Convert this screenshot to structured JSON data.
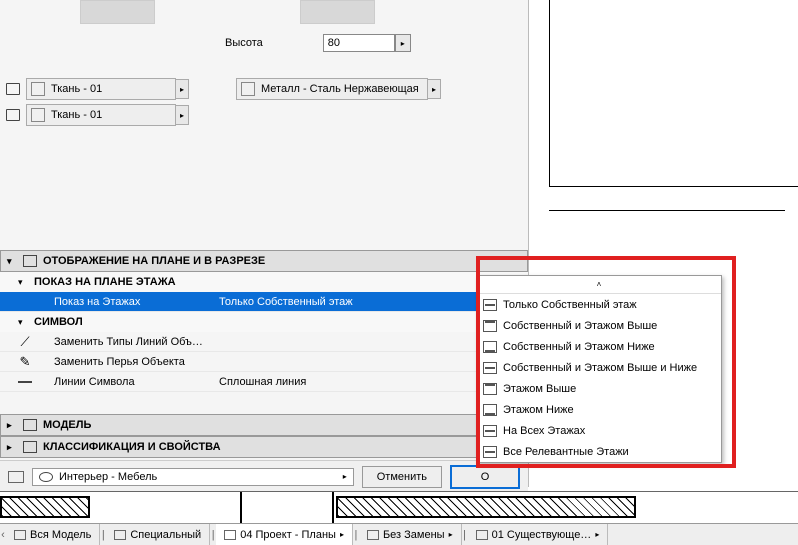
{
  "height": {
    "label": "Высота",
    "value": "80"
  },
  "materials": {
    "fabric1": "Ткань - 01",
    "fabric2": "Ткань - 01",
    "metal": "Металл - Сталь Нержавеющая"
  },
  "sections": {
    "display": {
      "title": "ОТОБРАЖЕНИЕ НА ПЛАНЕ И В РАЗРЕЗЕ"
    },
    "floorplan_show": {
      "title": "ПОКАЗ НА ПЛАНЕ ЭТАЖА"
    },
    "symbol": {
      "title": "СИМВОЛ"
    },
    "model": {
      "title": "МОДЕЛЬ"
    },
    "class": {
      "title": "КЛАССИФИКАЦИЯ И СВОЙСТВА"
    }
  },
  "props": {
    "show_on_floors": {
      "label": "Показ на Этажах",
      "value": "Только Собственный этаж"
    },
    "replace_line_types": {
      "label": "Заменить Типы Линий Объ…"
    },
    "replace_pens": {
      "label": "Заменить Перья Объекта"
    },
    "symbol_lines": {
      "label": "Линии Символа",
      "value": "Сплошная линия"
    }
  },
  "dropdown": [
    "Только Собственный этаж",
    "Собственный и Этажом Выше",
    "Собственный и Этажом Ниже",
    "Собственный и Этажом Выше и Ниже",
    "Этажом Выше",
    "Этажом Ниже",
    "На Всех Этажах",
    "Все Релевантные Этажи"
  ],
  "buttons": {
    "cancel": "Отменить",
    "ok": "О"
  },
  "layer": "Интерьер - Мебель",
  "tabs": {
    "all_model": "Вся Модель",
    "special": "Специальный",
    "project_plans": "04 Проект - Планы",
    "no_replace": "Без Замены",
    "existing": "01 Существующе…"
  }
}
